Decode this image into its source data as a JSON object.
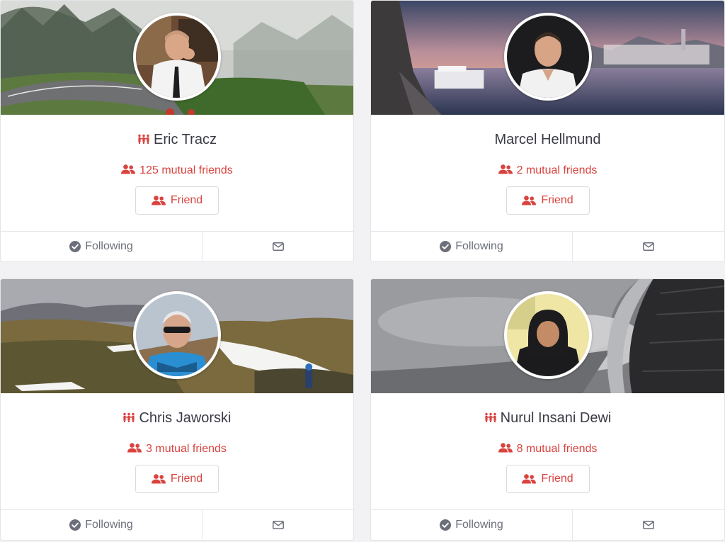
{
  "colors": {
    "accent": "#d9433f",
    "muted": "#6c6f7a",
    "text": "#3a3b45",
    "background": "#f2f2f4"
  },
  "cards": [
    {
      "name": "Eric Tracz",
      "has_brand_icon": true,
      "mutual": "125 mutual friends",
      "friend_label": "Friend",
      "following_label": "Following",
      "cover": "foggy-road-forest",
      "avatar": "man-white-shirt-tie"
    },
    {
      "name": "Marcel Hellmund",
      "has_brand_icon": false,
      "mutual": "2 mutual friends",
      "friend_label": "Friend",
      "following_label": "Following",
      "cover": "river-town-sunset",
      "avatar": "man-dark-background"
    },
    {
      "name": "Chris Jaworski",
      "has_brand_icon": true,
      "mutual": "3 mutual friends",
      "friend_label": "Friend",
      "following_label": "Following",
      "cover": "mountain-snow-hikers",
      "avatar": "man-sunglasses"
    },
    {
      "name": "Nurul Insani Dewi",
      "has_brand_icon": true,
      "mutual": "8 mutual friends",
      "friend_label": "Friend",
      "following_label": "Following",
      "cover": "cloudy-sky-architecture",
      "avatar": "woman-hijab"
    }
  ],
  "icons": {
    "brand": "company-people-icon",
    "mutual": "users-icon",
    "friend": "user-friends-icon",
    "following": "check-circle-icon",
    "message": "envelope-icon"
  }
}
